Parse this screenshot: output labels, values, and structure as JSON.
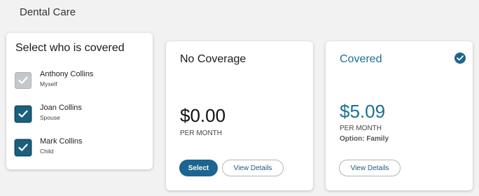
{
  "section": {
    "title": "Dental Care"
  },
  "who": {
    "title": "Select who is covered",
    "members": [
      {
        "name": "Anthony Collins",
        "relation": "Myself",
        "checked": true,
        "disabled": true
      },
      {
        "name": "Joan Collins",
        "relation": "Spouse",
        "checked": true,
        "disabled": false
      },
      {
        "name": "Mark Collins",
        "relation": "Child",
        "checked": true,
        "disabled": false
      }
    ]
  },
  "plans": {
    "no_coverage": {
      "title": "No Coverage",
      "price": "$0.00",
      "period": "PER MONTH",
      "select_label": "Select",
      "details_label": "View Details"
    },
    "covered": {
      "title": "Covered",
      "price": "$5.09",
      "period": "PER MONTH",
      "option": "Option: Family",
      "details_label": "View Details",
      "selected": true
    }
  },
  "colors": {
    "accent": "#1b6590",
    "accent_text": "#1b6f96",
    "checkbox_checked": "#1b5f7d",
    "checkbox_disabled": "#c4c8cb"
  },
  "icons": {
    "checkbox_check": "check-icon",
    "selected_badge": "check-circle-icon"
  }
}
